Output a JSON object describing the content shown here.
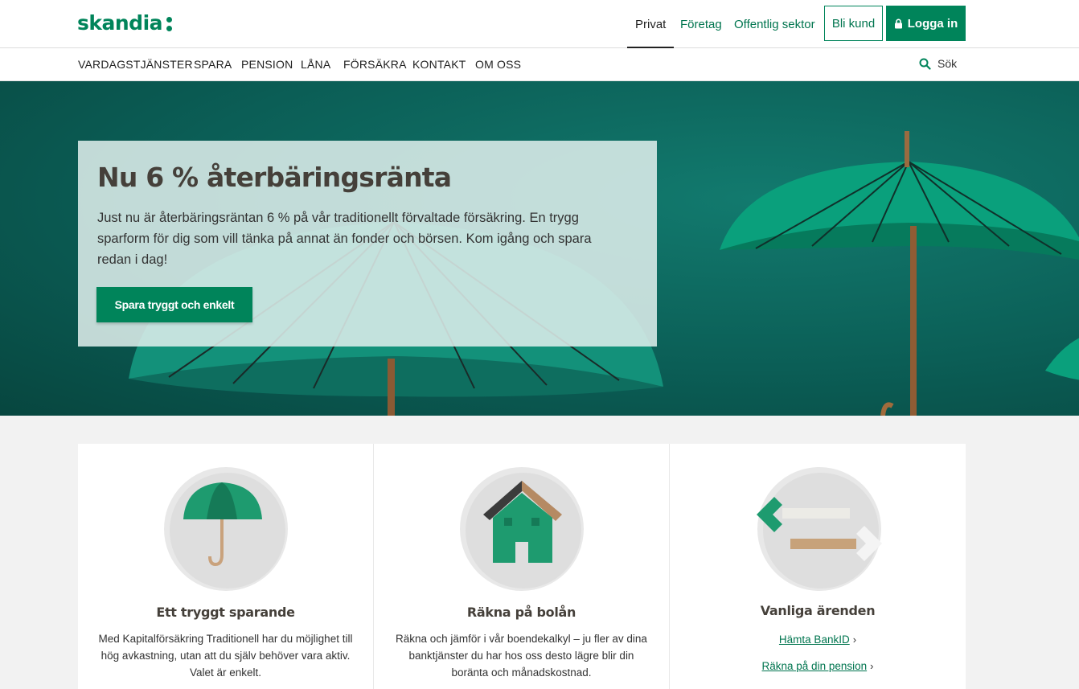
{
  "header": {
    "logo": "skandia",
    "segments": [
      {
        "label": "Privat",
        "active": true
      },
      {
        "label": "Företag",
        "active": false
      },
      {
        "label": "Offentlig sektor",
        "active": false
      }
    ],
    "become_customer": "Bli kund",
    "login": "Logga in"
  },
  "nav": {
    "items": [
      "VARDAGSTJÄNSTER",
      "SPARA",
      "PENSION",
      "LÅNA",
      "FÖRSÄKRA",
      "KONTAKT",
      "OM OSS"
    ],
    "search_label": "Sök"
  },
  "hero": {
    "title": "Nu 6 % återbäringsränta",
    "text": "Just nu är återbäringsräntan 6 % på vår traditionellt förvaltade försäkring. En trygg sparform för dig som vill tänka på annat än fonder och börsen. Kom igång och spara redan i dag!",
    "cta": "Spara tryggt och enkelt"
  },
  "cards": [
    {
      "title": "Ett tryggt sparande",
      "text": "Med Kapitalförsäkring Traditionell har du möjlighet till hög avkastning, utan att du själv behöver vara aktiv. Valet är enkelt."
    },
    {
      "title": "Räkna på bolån",
      "text": "Räkna och jämför i vår boendekalkyl – ju fler av dina banktjänster du har hos oss desto lägre blir din boränta och månadskostnad."
    },
    {
      "title": "Vanliga ärenden",
      "links": [
        "Hämta BankID",
        "Räkna på din pension"
      ]
    }
  ],
  "colors": {
    "brand_green": "#00845a",
    "hero_teal": "#0b5e56",
    "title_brown": "#45403a"
  }
}
